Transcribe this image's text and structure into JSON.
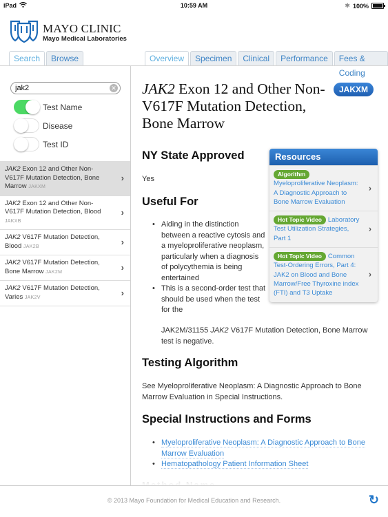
{
  "statusbar": {
    "device": "iPad",
    "time": "10:59 AM",
    "battery": "100%"
  },
  "logo": {
    "title": "MAYO CLINIC",
    "subtitle": "Mayo Medical Laboratories"
  },
  "left_tabs": [
    {
      "label": "Search",
      "active": true
    },
    {
      "label": "Browse",
      "active": false
    }
  ],
  "right_tabs": [
    {
      "label": "Overview",
      "active": true
    },
    {
      "label": "Specimen",
      "active": false
    },
    {
      "label": "Clinical",
      "active": false
    },
    {
      "label": "Performance",
      "active": false
    },
    {
      "label": "Fees & Coding",
      "active": false
    }
  ],
  "search": {
    "value": "jak2",
    "placeholder": ""
  },
  "filters": [
    {
      "label": "Test Name",
      "on": true
    },
    {
      "label": "Disease",
      "on": false
    },
    {
      "label": "Test ID",
      "on": false
    }
  ],
  "results": [
    {
      "gene": "JAK2",
      "name": " Exon 12 and Other Non-V617F Mutation Detection, Bone Marrow",
      "code": "JAKXM",
      "selected": true
    },
    {
      "gene": "JAK2",
      "name": " Exon 12 and Other Non-V617F Mutation Detection, Blood",
      "code": "JAKXB",
      "selected": false
    },
    {
      "gene": "JAK2",
      "name": " V617F Mutation Detection, Blood",
      "code": "JAK2B",
      "selected": false
    },
    {
      "gene": "JAK2",
      "name": " V617F Mutation Detection, Bone Marrow",
      "code": "JAK2M",
      "selected": false
    },
    {
      "gene": "JAK2",
      "name": " V617F Mutation Detection, Varies",
      "code": "JAK2V",
      "selected": false
    }
  ],
  "detail": {
    "title_gene": "JAK2",
    "title_rest": " Exon 12 and Other Non-V617F Mutation Detection, Bone Marrow",
    "badge": "JAKXM",
    "ny_heading": "NY State Approved",
    "ny_value": "Yes",
    "useful_heading": "Useful For",
    "useful_items": [
      "Aiding in the distinction between a reactive cytosis and a myeloproliferative neoplasm, particularly when a diagnosis of polycythemia is being entertained",
      "This is a second-order test that should be used when the test for the"
    ],
    "useful_item2_cont_a": "JAK2M/31155 ",
    "useful_item2_cont_gene": "JAK2",
    "useful_item2_cont_b": " V617F Mutation Detection, Bone Marrow test is negative.",
    "algorithm_heading": "Testing Algorithm",
    "algorithm_text": "See Myeloproliferative Neoplasm: A Diagnostic Approach to Bone Marrow Evaluation in Special Instructions.",
    "special_heading": "Special Instructions and Forms",
    "special_links": [
      "Myeloproliferative Neoplasm: A Diagnostic Approach to Bone Marrow Evaluation",
      "Hematopathology Patient Information Sheet"
    ],
    "next_heading_partial": "Method Name"
  },
  "resources": {
    "heading": "Resources",
    "items": [
      {
        "tag": "Algorithm",
        "text": "Myeloproliferative Neoplasm: A Diagnostic Approach to Bone Marrow Evaluation"
      },
      {
        "tag": "Hot Topic Video",
        "text": "Laboratory Test Utilization Strategies, Part 1"
      },
      {
        "tag": "Hot Topic Video",
        "text": "Common Test-Ordering Errors, Part 4: JAK2 on Blood and Bone Marrow/Free Thyroxine index (FTI) and T3 Uptake"
      }
    ]
  },
  "footer": {
    "copyright": "© 2013 Mayo Foundation for Medical Education and Research."
  },
  "colors": {
    "accent": "#3a8ad6",
    "badge": "#1f5fb1",
    "toggle_on": "#4cd964",
    "pill": "#64a732"
  }
}
